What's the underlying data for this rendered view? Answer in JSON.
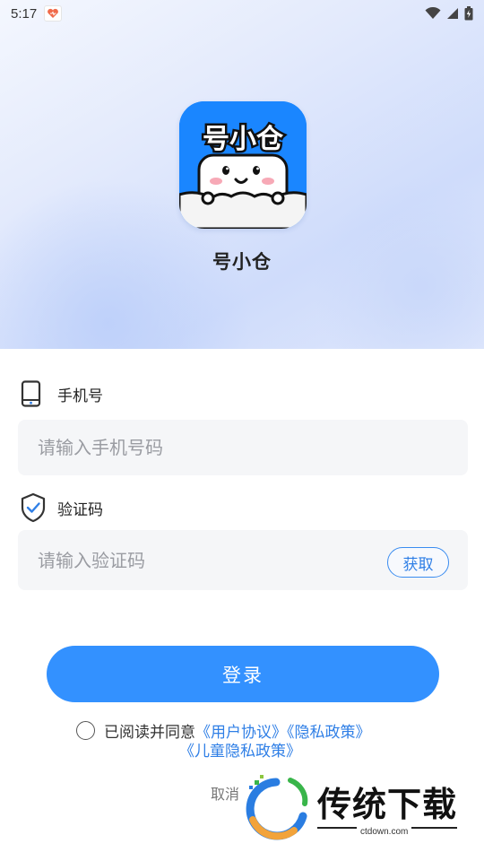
{
  "status_bar": {
    "time": "5:17"
  },
  "app": {
    "name": "号小仓",
    "logo_text": "号小仓"
  },
  "phone": {
    "label": "手机号",
    "placeholder": "请输入手机号码",
    "value": ""
  },
  "code": {
    "label": "验证码",
    "placeholder": "请输入验证码",
    "value": "",
    "get_code_label": "获取"
  },
  "login": {
    "label": "登录"
  },
  "agreement": {
    "prefix": "已阅读并同意",
    "user_agreement": "《用户协议》",
    "privacy_policy": "《隐私政策》",
    "child_privacy": "《儿童隐私政策》",
    "checked": false
  },
  "cancel": {
    "label": "取消"
  },
  "watermark": {
    "text": "传统下载",
    "url": "ctdown.com"
  },
  "colors": {
    "primary": "#3391ff",
    "link": "#2f7fe6",
    "input_bg": "#f5f6f8"
  }
}
